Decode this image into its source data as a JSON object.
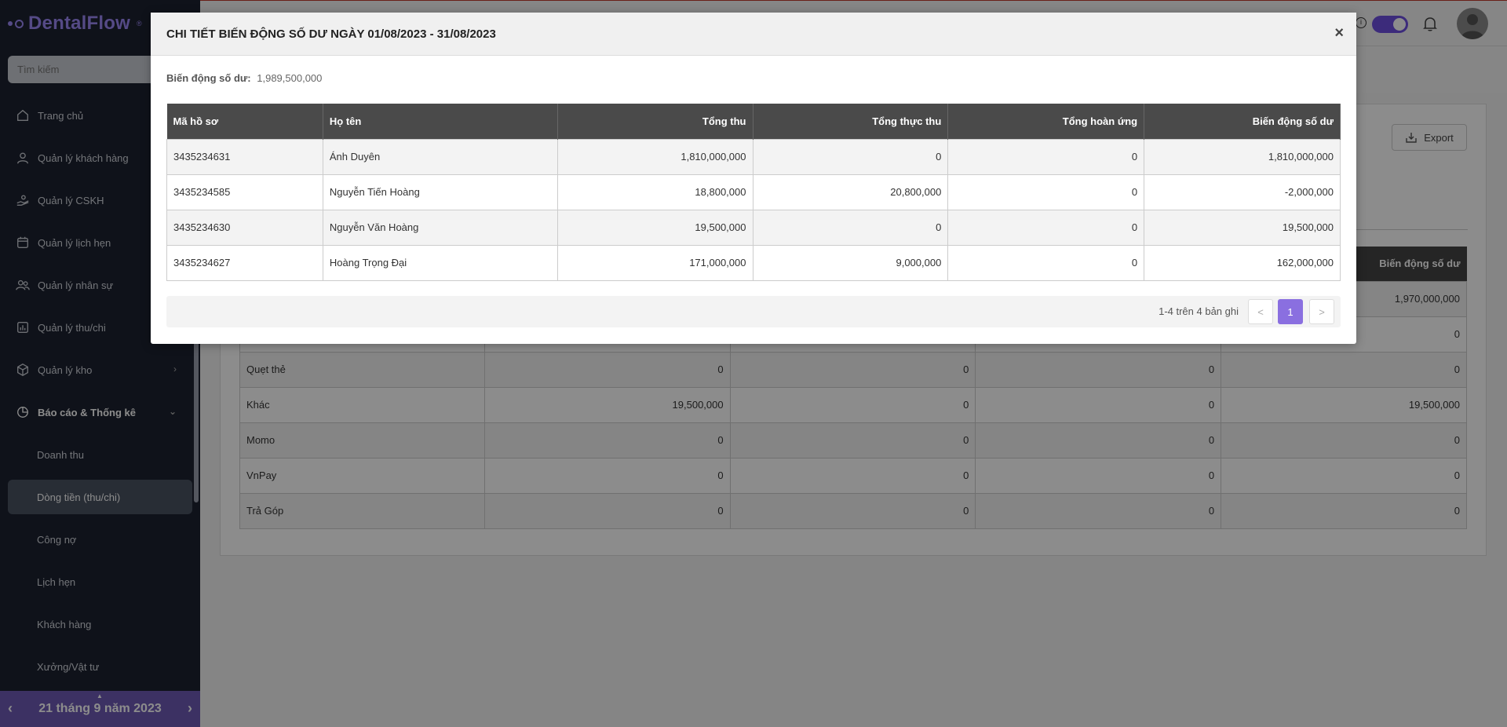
{
  "app": {
    "brand": "DentalFlow",
    "trademark": "®"
  },
  "sidebar": {
    "search_placeholder": "Tìm kiếm",
    "items": [
      {
        "label": "Trang chủ",
        "icon": "home-icon"
      },
      {
        "label": "Quản lý khách hàng",
        "icon": "user-icon"
      },
      {
        "label": "Quản lý CSKH",
        "icon": "hand-heart-icon"
      },
      {
        "label": "Quản lý lịch hẹn",
        "icon": "calendar-icon"
      },
      {
        "label": "Quản lý nhân sự",
        "icon": "users-icon"
      },
      {
        "label": "Quản lý thu/chi",
        "icon": "chart-bar-icon"
      },
      {
        "label": "Quản lý kho",
        "icon": "box-icon"
      },
      {
        "label": "Báo cáo & Thống kê",
        "icon": "pie-chart-icon"
      }
    ],
    "sub_items": [
      {
        "label": "Doanh thu"
      },
      {
        "label": "Dòng tiền (thu/chi)"
      },
      {
        "label": "Công nợ"
      },
      {
        "label": "Lịch hẹn"
      },
      {
        "label": "Khách hàng"
      },
      {
        "label": "Xưởng/Vật tư"
      }
    ],
    "date": "21 tháng 9 năm 2023"
  },
  "page": {
    "export_label": "Export",
    "bg_header_last": "Biến động số dư",
    "bg_rows": [
      {
        "name": "",
        "c1": "",
        "c2": "",
        "c3": "",
        "c4": "1,970,000,000"
      },
      {
        "name": "",
        "c1": "",
        "c2": "",
        "c3": "",
        "c4": "0"
      },
      {
        "name": "Quẹt thẻ",
        "c1": "0",
        "c2": "0",
        "c3": "0",
        "c4": "0"
      },
      {
        "name": "Khác",
        "c1": "19,500,000",
        "c2": "0",
        "c3": "0",
        "c4": "19,500,000"
      },
      {
        "name": "Momo",
        "c1": "0",
        "c2": "0",
        "c3": "0",
        "c4": "0"
      },
      {
        "name": "VnPay",
        "c1": "0",
        "c2": "0",
        "c3": "0",
        "c4": "0"
      },
      {
        "name": "Trả Góp",
        "c1": "0",
        "c2": "0",
        "c3": "0",
        "c4": "0"
      }
    ]
  },
  "modal": {
    "title": "CHI TIẾT BIẾN ĐỘNG SỐ DƯ NGÀY 01/08/2023 - 31/08/2023",
    "close": "×",
    "balance_label": "Biến động số dư:",
    "balance_value": "1,989,500,000",
    "columns": [
      "Mã hồ sơ",
      "Họ tên",
      "Tổng thu",
      "Tổng thực thu",
      "Tổng hoàn ứng",
      "Biến động số dư"
    ],
    "rows": [
      {
        "id": "3435234631",
        "name": "Ánh Duyên",
        "total": "1,810,000,000",
        "actual": "0",
        "refund": "0",
        "balance": "1,810,000,000"
      },
      {
        "id": "3435234585",
        "name": "Nguyễn Tiến Hoàng",
        "total": "18,800,000",
        "actual": "20,800,000",
        "refund": "0",
        "balance": "-2,000,000"
      },
      {
        "id": "3435234630",
        "name": "Nguyễn Văn Hoàng",
        "total": "19,500,000",
        "actual": "0",
        "refund": "0",
        "balance": "19,500,000"
      },
      {
        "id": "3435234627",
        "name": "Hoàng Trọng Đại",
        "total": "171,000,000",
        "actual": "9,000,000",
        "refund": "0",
        "balance": "162,000,000"
      }
    ],
    "pager_info": "1-4 trên 4 bản ghi",
    "current_page": "1",
    "prev": "<",
    "next": ">"
  },
  "colors": {
    "accent": "#8a6fe0",
    "sidebar_bg": "#1c2230",
    "link": "#8a72d8"
  }
}
